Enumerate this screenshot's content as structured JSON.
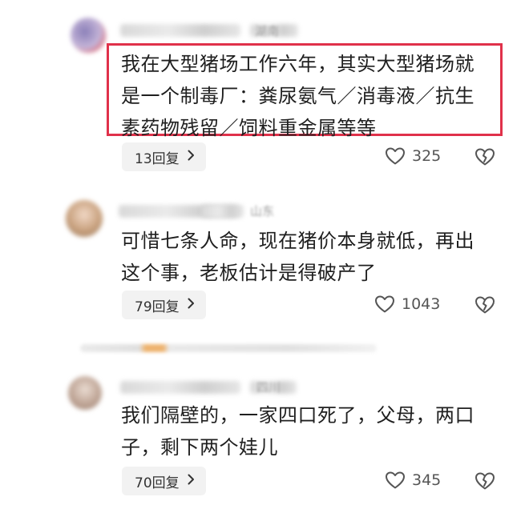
{
  "comments": [
    {
      "location": "湖南",
      "text_lines": [
        "我在大型猪场工作六年，其实大型猪场就",
        "是一个制毒厂：粪尿氨气／消毒液／抗生",
        "素药物残留／饲料重金属等等"
      ],
      "reply_label": "13回复",
      "likes": "325",
      "highlighted": true
    },
    {
      "location": "山东",
      "text_lines": [
        "可惜七条人命，现在猪价本身就低，再出",
        "这个事，老板估计是得破产了"
      ],
      "reply_label": "79回复",
      "likes": "1043",
      "highlighted": false
    },
    {
      "location": "四川",
      "text_lines": [
        "我们隔壁的，一家四口死了，父母，两口",
        "子，剩下两个娃儿"
      ],
      "reply_label": "70回复",
      "likes": "345",
      "highlighted": false
    }
  ],
  "colors": {
    "highlight_border": "#e0314a",
    "reply_bg": "#f2f2f2",
    "text": "#1f1f1f",
    "meta": "#9a9a9a"
  },
  "icons": {
    "like": "heart-outline-icon",
    "dislike": "broken-heart-icon",
    "reply_chevron": "chevron-right-icon"
  }
}
